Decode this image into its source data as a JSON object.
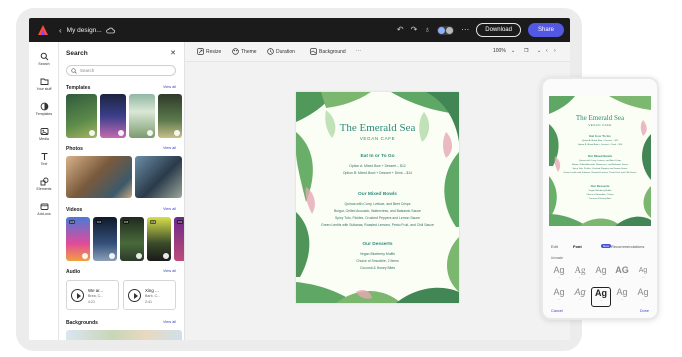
{
  "topbar": {
    "doc_title": "My design...",
    "download_label": "Download",
    "share_label": "Share"
  },
  "rail": {
    "items": [
      {
        "label": "Search",
        "icon": "search-icon"
      },
      {
        "label": "Your stuff",
        "icon": "folder-icon"
      },
      {
        "label": "Templates",
        "icon": "templates-icon"
      },
      {
        "label": "Media",
        "icon": "media-icon"
      },
      {
        "label": "Text",
        "icon": "text-icon"
      },
      {
        "label": "Elements",
        "icon": "elements-icon"
      },
      {
        "label": "Add-ons",
        "icon": "add-ons-icon"
      }
    ]
  },
  "panel": {
    "title": "Search",
    "search_placeholder": "Search",
    "view_all_label": "View all",
    "sections": {
      "templates": "Templates",
      "photos": "Photos",
      "videos": "Videos",
      "audio": "Audio",
      "backgrounds": "Backgrounds"
    },
    "videos": [
      {
        "duration": "0:6"
      },
      {
        "duration": "0:6"
      },
      {
        "duration": "0:6"
      },
      {
        "duration": "0:6"
      },
      {
        "duration": "0:6"
      }
    ],
    "audio": [
      {
        "title": "We ar...",
        "artist": "Brea, C...",
        "duration": "4:21"
      },
      {
        "title": "Xing ...",
        "artist": "Barb, C...",
        "duration": "2:41"
      }
    ]
  },
  "toolbar": {
    "resize": "Resize",
    "theme": "Theme",
    "duration": "Duration",
    "background": "Background",
    "more": "···",
    "zoom": "100%"
  },
  "poster": {
    "title": "The Emerald Sea",
    "subtitle": "VEGAN CAFE",
    "sections": [
      {
        "heading": "Eat In or To Go",
        "lines": [
          "Option A: Mixed Bow + Dessert – $12",
          "Option B: Mixed Bowl + Dessert + Drink – $14"
        ]
      },
      {
        "heading": "Our Mixed Bowls",
        "lines": [
          "Quinoa with Curry, Lettuce, and Beet Crisps",
          "Bulgur, Grilled Avocado, Watercress, and Balsamic Sauce",
          "Spicy Tofu, Pickles, Crushed Peppers and Lemon Sauce",
          "Green Lentils with Sultanas, Roasted Lemons, Pesto Fruit, and Chili Sauce"
        ]
      },
      {
        "heading": "Our Desserts",
        "lines": [
          "Vegan Blueberry Muffin",
          "Choice of Smoothie, 2 Items",
          "Coconut & Honey Bites"
        ]
      }
    ]
  },
  "phone": {
    "tabs": [
      "Edit",
      "Font",
      "Recommendations"
    ],
    "new_badge": "New",
    "caption": "Unmade",
    "font_samples": [
      "Ag",
      "Ag",
      "Ag",
      "AG",
      "Ag",
      "Ag",
      "Ag",
      "Ag",
      "Ag",
      "Ag"
    ],
    "selected_font_index": 7,
    "cancel_label": "Cancel",
    "done_label": "Done"
  },
  "colors": {
    "accent": "#5258e4",
    "link": "#3a45c8",
    "poster_green": "#2f8a7c",
    "topbar": "#1b1b1b"
  }
}
